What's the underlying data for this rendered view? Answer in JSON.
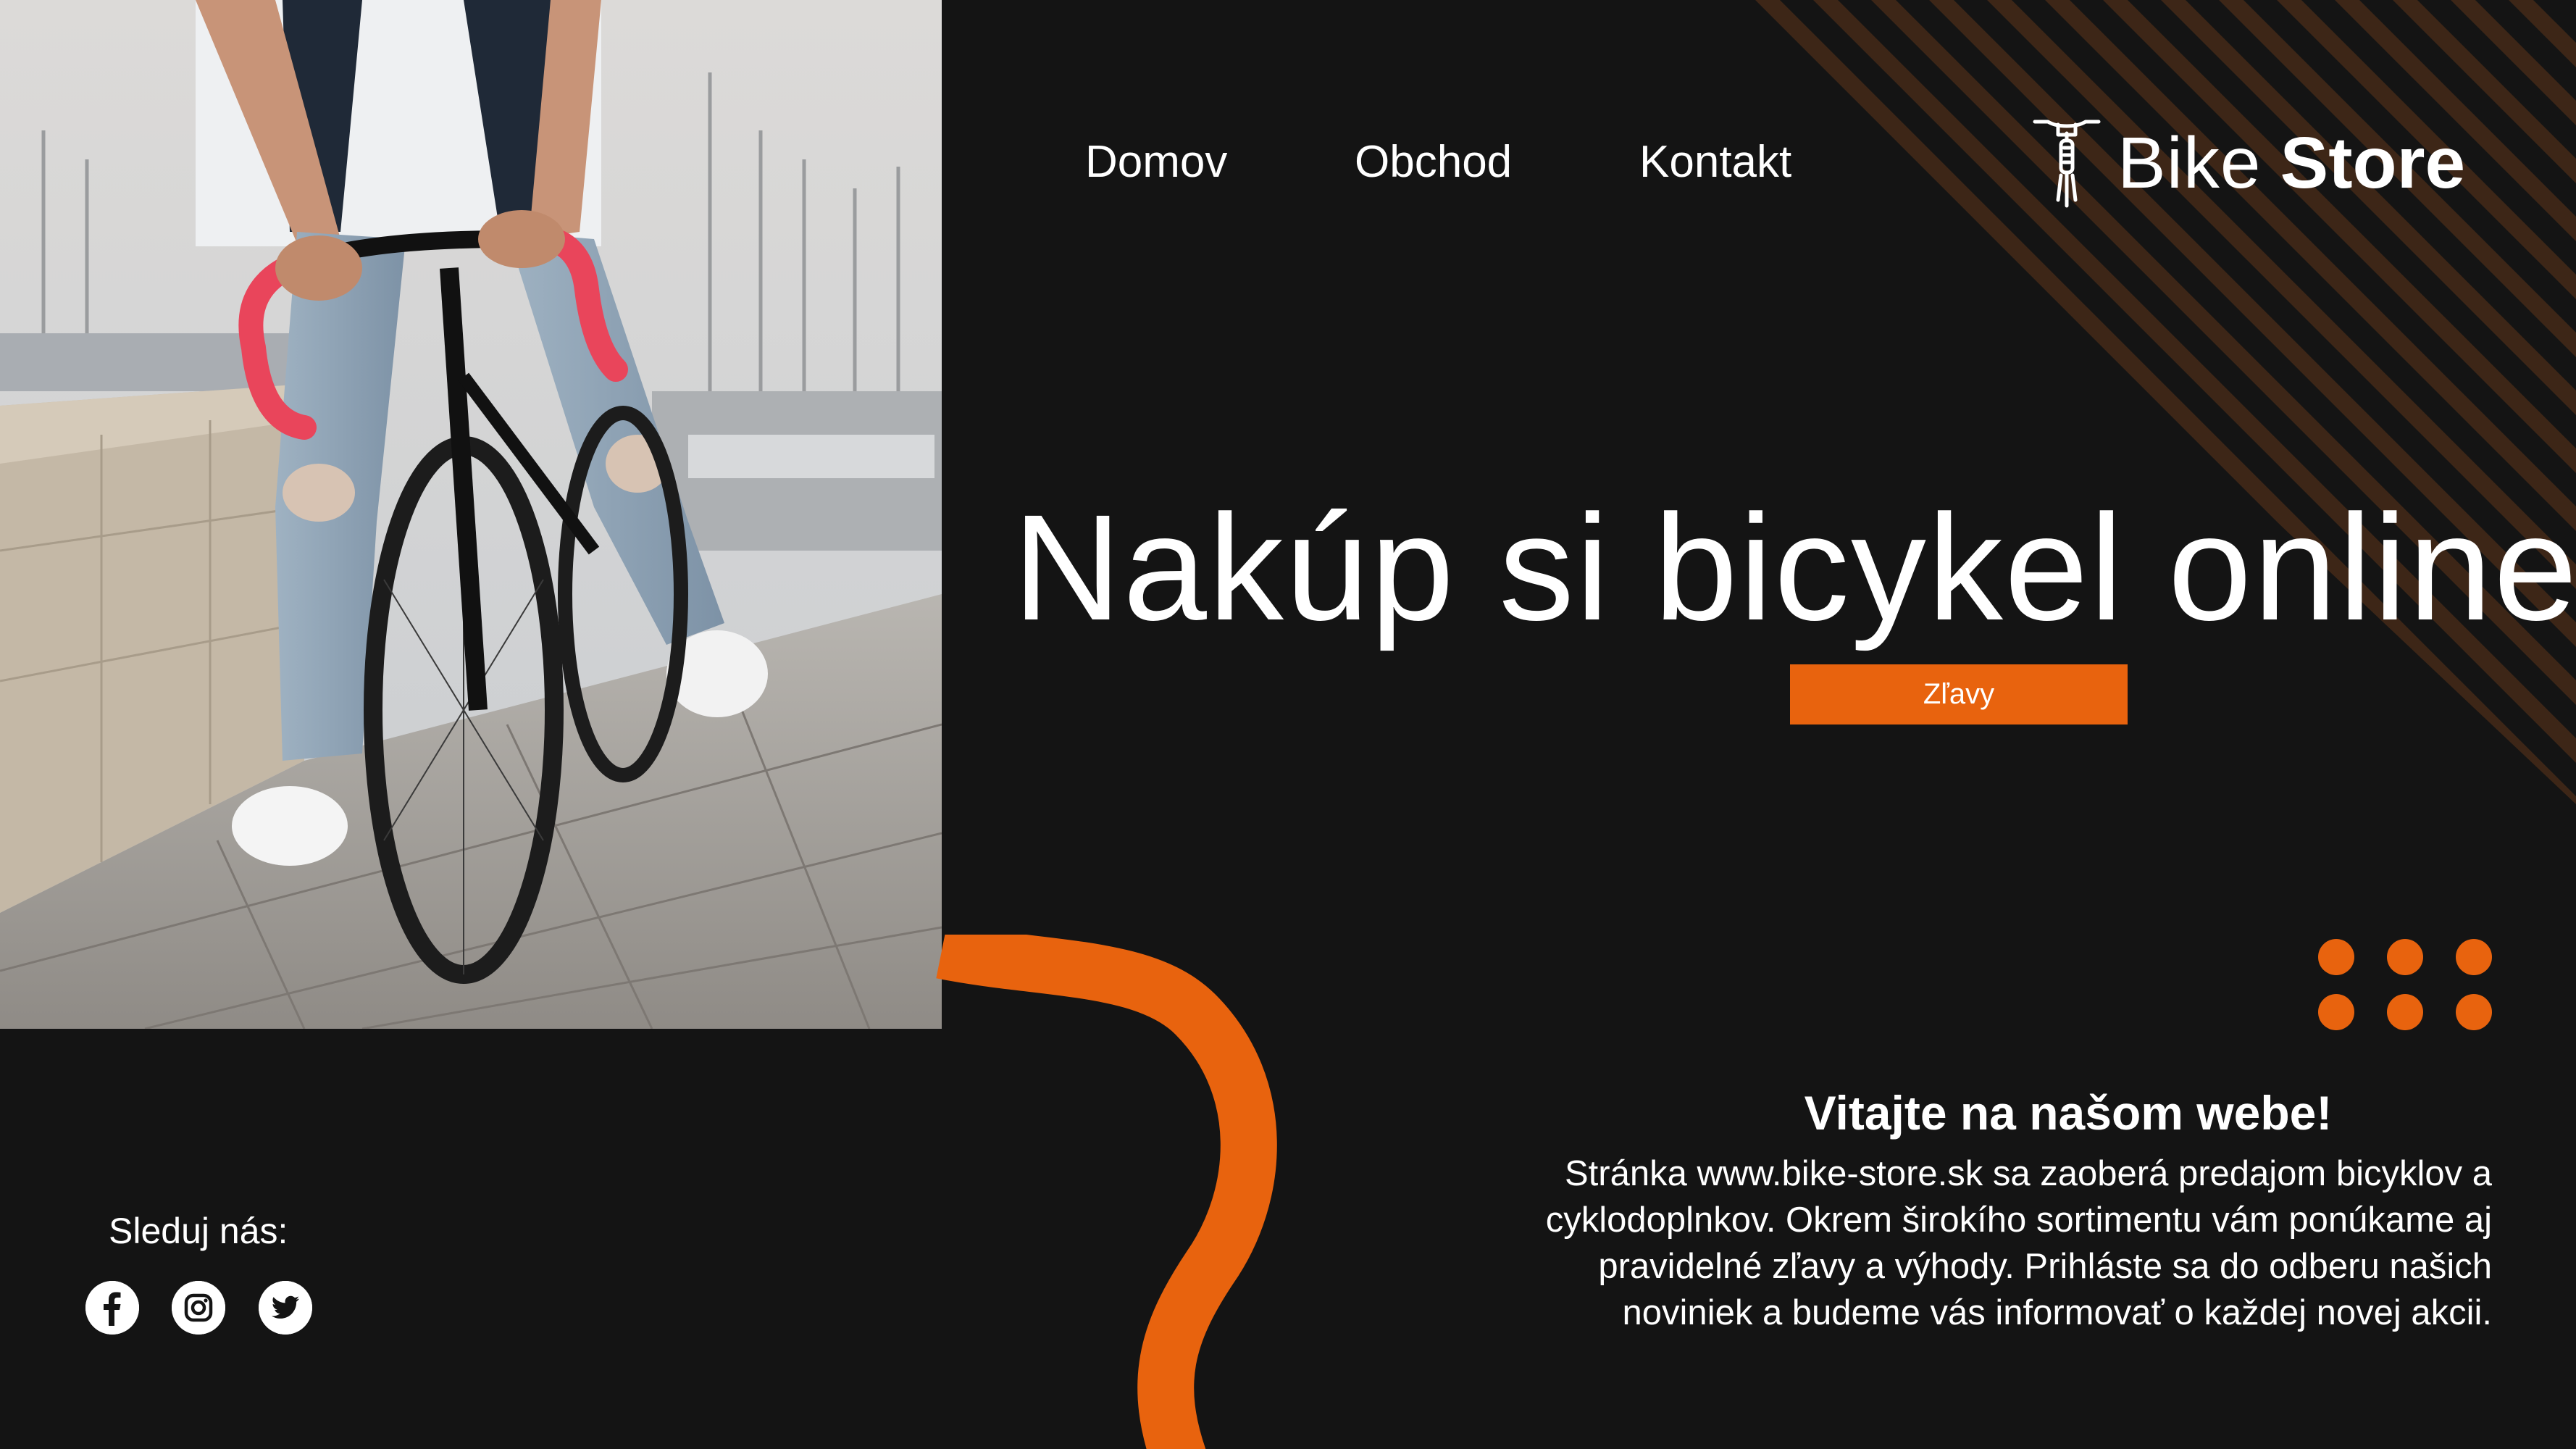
{
  "nav": {
    "items": [
      {
        "label": "Domov"
      },
      {
        "label": "Obchod"
      },
      {
        "label": "Kontakt"
      }
    ]
  },
  "logo": {
    "word1": "Bike",
    "word2": "Store",
    "icon": "bicycle-front-icon"
  },
  "hero": {
    "headline": "Nakúp si bicykel online",
    "button_label": "Zľavy",
    "photo": "man-on-road-bike-photo"
  },
  "welcome": {
    "title": "Vitajte na našom webe!",
    "text": "Stránka www.bike-store.sk sa zaoberá predajom bicyklov a cyklodoplnkov. Okrem širokího sortimentu vám ponúkame aj pravidelné zľavy a výhody. Prihláste sa do odberu našich noviniek a budeme vás informovať o každej novej akcii."
  },
  "social": {
    "label": "Sleduj nás:",
    "icons": [
      "facebook-icon",
      "instagram-icon",
      "twitter-icon"
    ]
  },
  "colors": {
    "background": "#141414",
    "accent": "#e8630e",
    "text": "#ffffff",
    "stripe": "#3a2417"
  }
}
